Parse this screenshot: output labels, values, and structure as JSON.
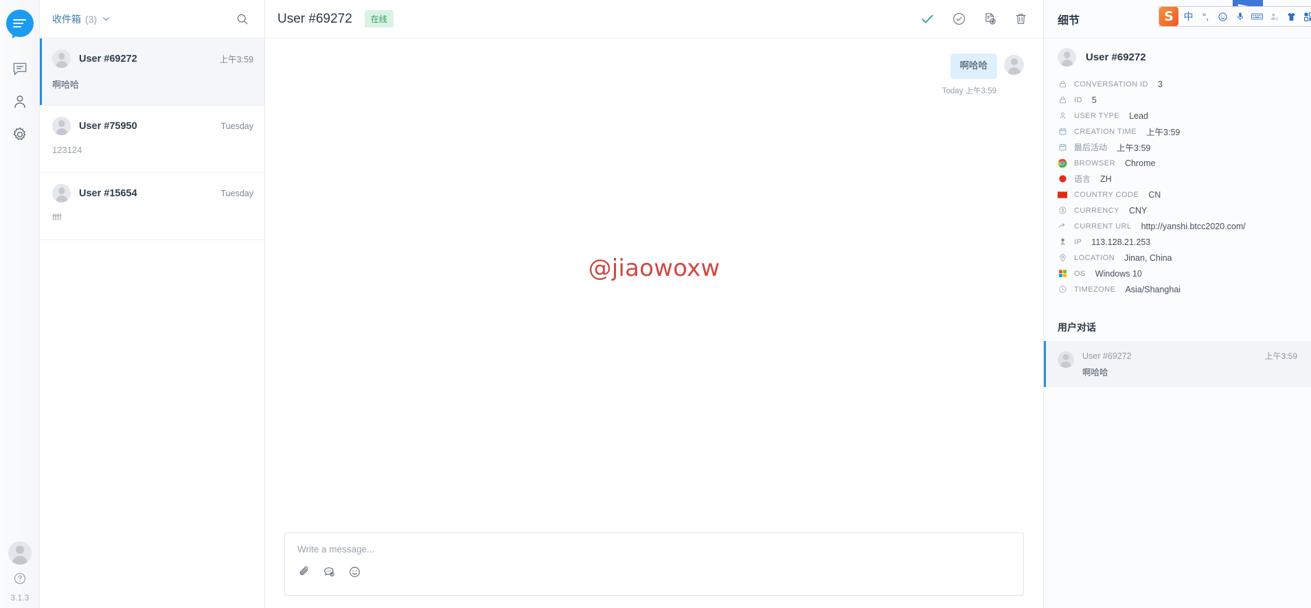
{
  "rail": {
    "logo": "chat-logo",
    "items": [
      {
        "name": "conversations-icon"
      },
      {
        "name": "contacts-icon"
      },
      {
        "name": "settings-icon"
      }
    ],
    "help": "?",
    "version": "3.1.3"
  },
  "list": {
    "inbox_label": "收件箱",
    "inbox_count": "(3)",
    "search_placeholder": "Search",
    "conversations": [
      {
        "name": "User #69272",
        "time": "上午3:59",
        "preview": "啊哈哈",
        "active": true
      },
      {
        "name": "User #75950",
        "time": "Tuesday",
        "preview": "123124",
        "active": false
      },
      {
        "name": "User #15654",
        "time": "Tuesday",
        "preview": "ffff",
        "active": false
      }
    ]
  },
  "chat": {
    "title": "User #69272",
    "status_badge": "在线",
    "actions": [
      {
        "name": "resolve-check-icon",
        "label": "Resolve"
      },
      {
        "name": "snooze-clock-icon",
        "label": "Snooze"
      },
      {
        "name": "export-transcript-icon",
        "label": "Export"
      },
      {
        "name": "delete-trash-icon",
        "label": "Delete"
      }
    ],
    "messages": [
      {
        "text": "啊哈哈",
        "time": "Today 上午3:59",
        "side": "right"
      }
    ],
    "watermark": "@jiaowoxw",
    "composer": {
      "placeholder": "Write a message...",
      "tools": [
        {
          "name": "attachment-icon"
        },
        {
          "name": "saved-replies-icon"
        },
        {
          "name": "emoji-icon"
        }
      ]
    }
  },
  "details": {
    "title": "细节",
    "user_name": "User #69272",
    "fields": [
      {
        "icon": "lock-icon",
        "label": "CONVERSATION ID",
        "value": "3",
        "cjk": false
      },
      {
        "icon": "lock-icon",
        "label": "ID",
        "value": "5",
        "cjk": false
      },
      {
        "icon": "user-icon",
        "label": "USER TYPE",
        "value": "Lead",
        "cjk": false
      },
      {
        "icon": "calendar-icon",
        "label": "CREATION TIME",
        "value": "上午3:59",
        "cjk": false
      },
      {
        "icon": "calendar-icon",
        "label": "最后活动",
        "value": "上午3:59",
        "cjk": true
      },
      {
        "icon": "chrome-icon",
        "label": "BROWSER",
        "value": "Chrome",
        "cjk": false
      },
      {
        "icon": "language-icon",
        "label": "语言",
        "value": "ZH",
        "cjk": true
      },
      {
        "icon": "flag-cn-icon",
        "label": "COUNTRY CODE",
        "value": "CN",
        "cjk": false
      },
      {
        "icon": "currency-icon",
        "label": "CURRENCY",
        "value": "CNY",
        "cjk": false
      },
      {
        "icon": "link-arrow-icon",
        "label": "CURRENT URL",
        "value": "http://yanshi.btcc2020.com/",
        "cjk": false
      },
      {
        "icon": "network-icon",
        "label": "IP",
        "value": "113.128.21.253",
        "cjk": false
      },
      {
        "icon": "location-pin-icon",
        "label": "LOCATION",
        "value": "Jinan, China",
        "cjk": false
      },
      {
        "icon": "windows-icon",
        "label": "OS",
        "value": "Windows 10",
        "cjk": false
      },
      {
        "icon": "clock-icon",
        "label": "TIMEZONE",
        "value": "Asia/Shanghai",
        "cjk": false
      }
    ],
    "conversations_title": "用户对话",
    "conversations": [
      {
        "name": "User #69272",
        "time": "上午3:59",
        "preview": "啊哈哈"
      }
    ]
  },
  "ime": {
    "logo": "S",
    "buttons": [
      "中",
      "°,",
      "☺",
      "🎤",
      "⌨",
      "⚙",
      "👕",
      "▦"
    ]
  },
  "colors": {
    "accent": "#2d8bd4",
    "logo_blue": "#1b9cf0",
    "online_green": "#2f9e63",
    "online_bg": "#d9f2e3",
    "bubble_blue": "#def0fd",
    "watermark_red": "#cd4a43"
  }
}
